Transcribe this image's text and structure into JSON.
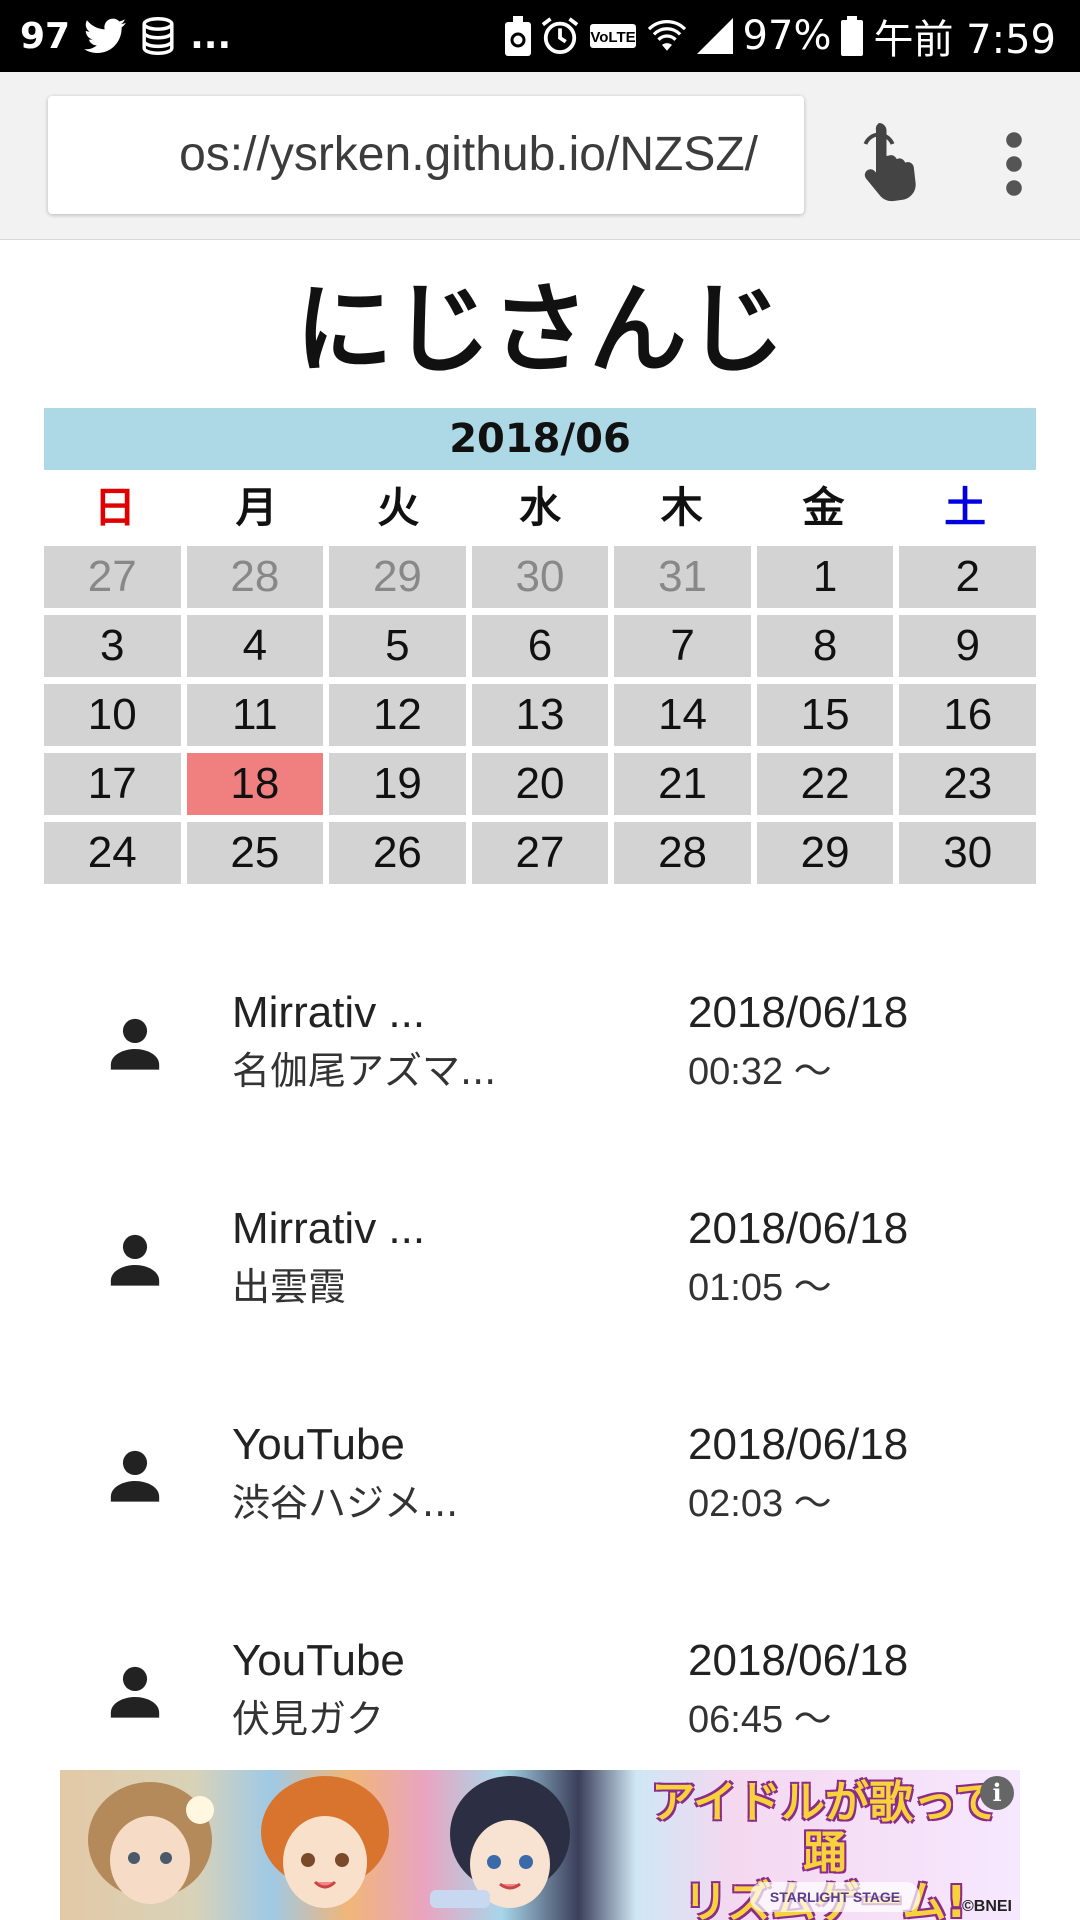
{
  "status_bar": {
    "notif_count": "97",
    "more": "...",
    "battery_pct": "97%",
    "time": "午前 7:59",
    "icons": [
      "twitter-icon",
      "coins-icon",
      "battery-saver-icon",
      "alarm-icon",
      "volte-icon",
      "wifi-icon",
      "signal-icon",
      "battery-icon"
    ]
  },
  "browser": {
    "url": "https://ysrken.github.io/NZSZ/",
    "url_visible": "os://ysrken.github.io/NZSZ/",
    "icons": [
      "touch-icon",
      "more-vert-icon"
    ]
  },
  "page": {
    "title": "にじさんじ"
  },
  "calendar": {
    "month_label": "2018/06",
    "weekdays": [
      "日",
      "月",
      "火",
      "水",
      "木",
      "金",
      "土"
    ],
    "days": [
      {
        "label": "27",
        "other": true
      },
      {
        "label": "28",
        "other": true
      },
      {
        "label": "29",
        "other": true
      },
      {
        "label": "30",
        "other": true
      },
      {
        "label": "31",
        "other": true
      },
      {
        "label": "1"
      },
      {
        "label": "2"
      },
      {
        "label": "3"
      },
      {
        "label": "4"
      },
      {
        "label": "5"
      },
      {
        "label": "6"
      },
      {
        "label": "7"
      },
      {
        "label": "8"
      },
      {
        "label": "9"
      },
      {
        "label": "10"
      },
      {
        "label": "11"
      },
      {
        "label": "12"
      },
      {
        "label": "13"
      },
      {
        "label": "14"
      },
      {
        "label": "15"
      },
      {
        "label": "16"
      },
      {
        "label": "17"
      },
      {
        "label": "18",
        "selected": true
      },
      {
        "label": "19"
      },
      {
        "label": "20"
      },
      {
        "label": "21"
      },
      {
        "label": "22"
      },
      {
        "label": "23"
      },
      {
        "label": "24"
      },
      {
        "label": "25"
      },
      {
        "label": "26"
      },
      {
        "label": "27"
      },
      {
        "label": "28"
      },
      {
        "label": "29"
      },
      {
        "label": "30"
      }
    ],
    "selected_color": "#f08080",
    "header_color": "#add8e6",
    "cell_color": "#d3d3d3"
  },
  "events": [
    {
      "source": "Mirrativ ...",
      "name": "名伽尾アズマ...",
      "date": "2018/06/18",
      "time": "00:32 〜",
      "icon": "person-icon"
    },
    {
      "source": "Mirrativ ...",
      "name": "出雲霞",
      "date": "2018/06/18",
      "time": "01:05 〜",
      "icon": "person-icon"
    },
    {
      "source": "YouTube",
      "name": "渋谷ハジメ...",
      "date": "2018/06/18",
      "time": "02:03 〜",
      "icon": "person-icon"
    },
    {
      "source": "YouTube",
      "name": "伏見ガク",
      "date": "2018/06/18",
      "time": "06:45 〜",
      "icon": "person-icon"
    }
  ],
  "ad": {
    "headline_1": "アイドルが歌って踊",
    "headline_2": "リズムゲーム!",
    "logo": "STARLIGHT STAGE",
    "copyright": "©BNEI",
    "info": "i"
  }
}
